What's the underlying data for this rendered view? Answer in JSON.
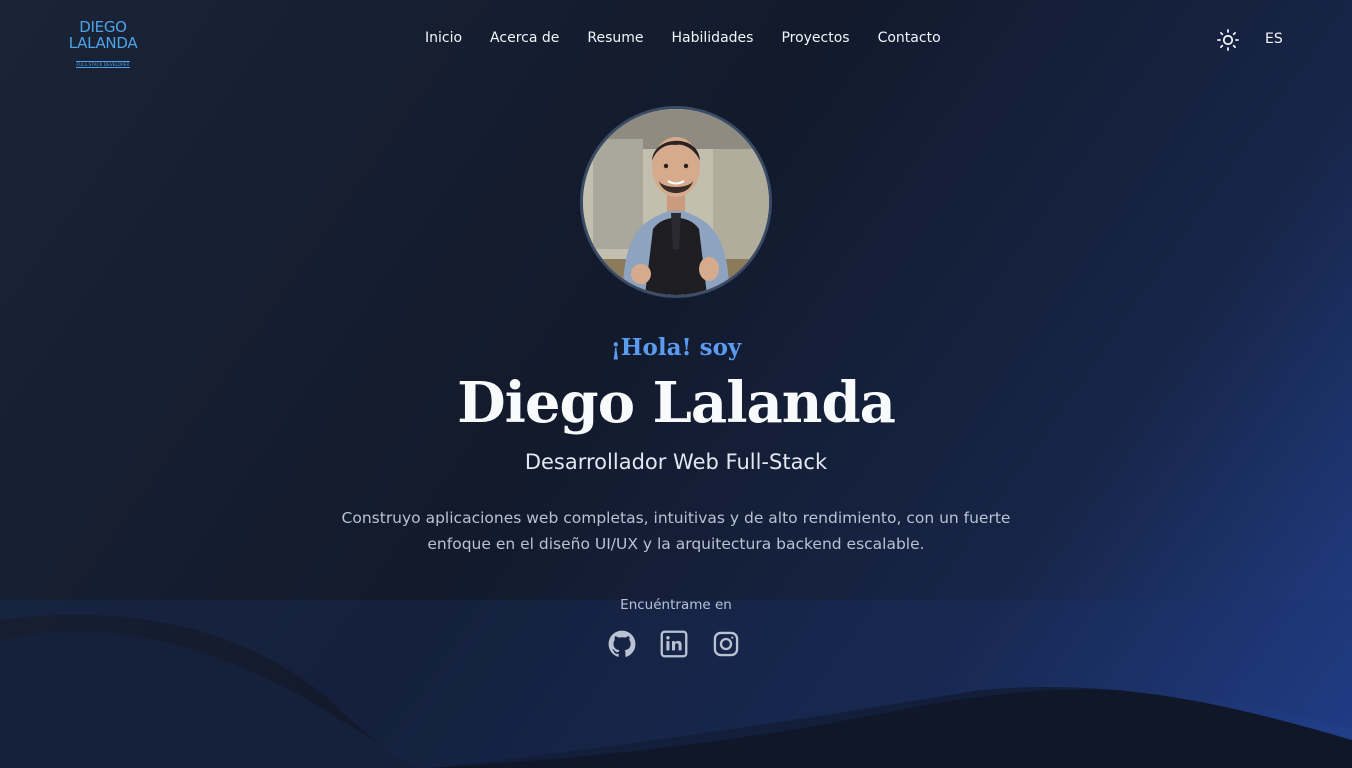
{
  "logo": {
    "line1": "DIEGO",
    "line2": "LALANDA",
    "tagline": "FULL-STACK DEVELOPER",
    "color": "#4ea3e8"
  },
  "nav": {
    "items": [
      "Inicio",
      "Acerca de",
      "Resume",
      "Habilidades",
      "Proyectos",
      "Contacto"
    ]
  },
  "header": {
    "theme_icon": "sun-icon",
    "language": "ES"
  },
  "hero": {
    "greeting": "¡Hola! soy",
    "name": "Diego Lalanda",
    "role": "Desarrollador Web Full-Stack",
    "description": "Construyo aplicaciones web completas, intuitivas y de alto rendimiento, con un fuerte enfoque en el diseño UI/UX y la arquitectura backend escalable.",
    "find_me": "Encuéntrame en",
    "socials": [
      "github-icon",
      "linkedin-icon",
      "instagram-icon"
    ]
  },
  "colors": {
    "accent": "#5b9cf0",
    "background": "#121a2c",
    "wave": "#1c3270"
  }
}
